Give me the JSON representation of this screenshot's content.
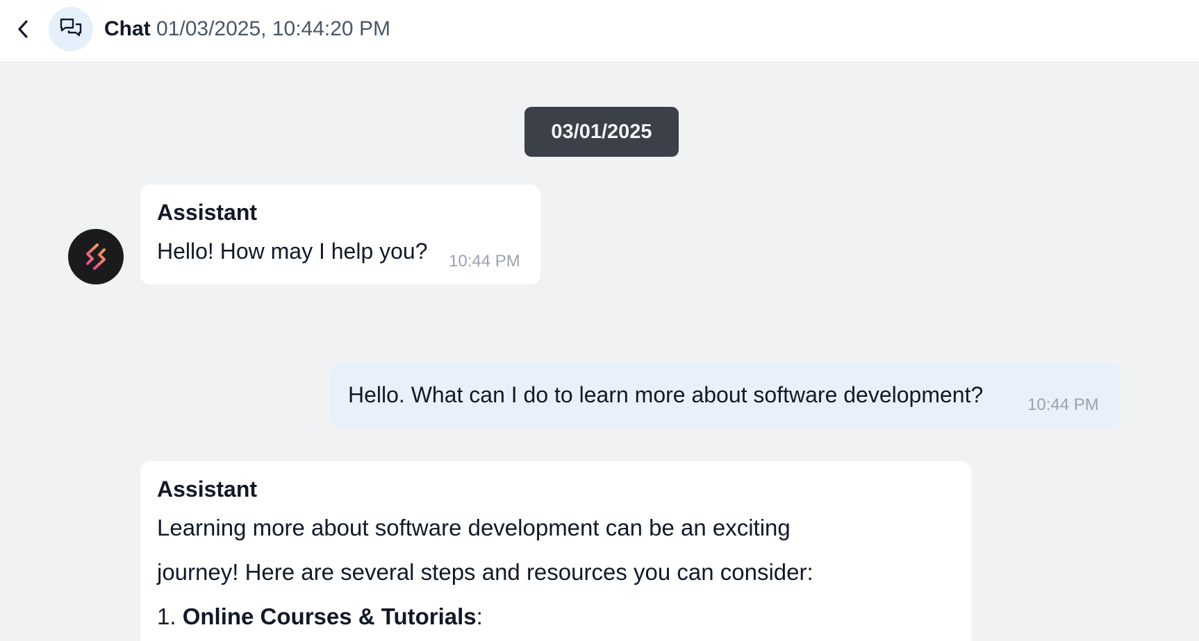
{
  "header": {
    "title": "Chat",
    "datetime": "01/03/2025, 10:44:20 PM",
    "back_icon": "chevron-left-icon",
    "chat_icon": "chat-bubbles-icon"
  },
  "date_divider": "03/01/2025",
  "messages": [
    {
      "role": "assistant",
      "sender": "Assistant",
      "text": "Hello! How may I help you?",
      "time": "10:44 PM"
    },
    {
      "role": "user",
      "text": "Hello. What can I do to learn more about software development?",
      "time": "10:44 PM"
    },
    {
      "role": "assistant",
      "sender": "Assistant",
      "lines": [
        "Learning more about software development can be an exciting",
        "journey! Here are several steps and resources you can consider:"
      ],
      "list_item_1": {
        "number": "1.",
        "bold": "Online Courses & Tutorials",
        "suffix": ":"
      }
    }
  ],
  "colors": {
    "background": "#f1f2f4",
    "user_bubble": "#e8f1fa",
    "assistant_bubble": "#ffffff",
    "date_pill": "#3b4049",
    "avatar_bg": "#1b1b1d",
    "avatar_logo_gradient_start": "#f59e5b",
    "avatar_logo_gradient_end": "#e84a8a"
  },
  "avatar_icon": "brand-logo-icon"
}
